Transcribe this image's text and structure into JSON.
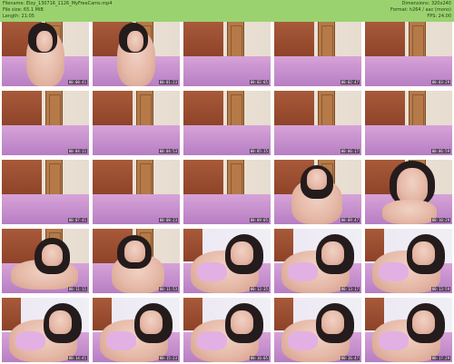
{
  "header": {
    "filename": "Filename: Eloy_130716_1126_MyFreeCams.mp4",
    "filesize": "File size: 65.1 MiB",
    "length": "Length: 21:05",
    "dimensions": "Dimensions: 320x240",
    "format": "Format: h264 / aac (mono)",
    "fps": "FPS: 24.00"
  },
  "header_color": "#9bd270",
  "thumbnails": [
    {
      "timestamp": "00:00:41",
      "scene": "girl-sitting"
    },
    {
      "timestamp": "00:01:23",
      "scene": "girl-sitting"
    },
    {
      "timestamp": "00:02:05",
      "scene": "empty-room"
    },
    {
      "timestamp": "00:02:47",
      "scene": "empty-room"
    },
    {
      "timestamp": "00:03:29",
      "scene": "empty-room"
    },
    {
      "timestamp": "00:04:11",
      "scene": "empty-room"
    },
    {
      "timestamp": "00:04:53",
      "scene": "empty-room"
    },
    {
      "timestamp": "00:05:35",
      "scene": "empty-room"
    },
    {
      "timestamp": "00:06:17",
      "scene": "empty-room"
    },
    {
      "timestamp": "00:06:59",
      "scene": "empty-room"
    },
    {
      "timestamp": "00:07:41",
      "scene": "empty-room"
    },
    {
      "timestamp": "00:08:23",
      "scene": "empty-room"
    },
    {
      "timestamp": "00:09:05",
      "scene": "empty-room"
    },
    {
      "timestamp": "00:09:47",
      "scene": "girl-leaning"
    },
    {
      "timestamp": "00:10:29",
      "scene": "girl-closeup"
    },
    {
      "timestamp": "00:11:11",
      "scene": "girl-lying"
    },
    {
      "timestamp": "00:11:53",
      "scene": "girl-chin-hand"
    },
    {
      "timestamp": "00:12:35",
      "scene": "girl-lying-bra"
    },
    {
      "timestamp": "00:13:17",
      "scene": "girl-lying-bra"
    },
    {
      "timestamp": "00:13:59",
      "scene": "girl-lying-bra"
    },
    {
      "timestamp": "00:14:41",
      "scene": "girl-lying-bra"
    },
    {
      "timestamp": "00:15:23",
      "scene": "girl-lying-bra"
    },
    {
      "timestamp": "00:16:05",
      "scene": "girl-lying-bra"
    },
    {
      "timestamp": "00:16:47",
      "scene": "girl-lying-bra"
    },
    {
      "timestamp": "00:17:29",
      "scene": "girl-lying-bra"
    }
  ]
}
